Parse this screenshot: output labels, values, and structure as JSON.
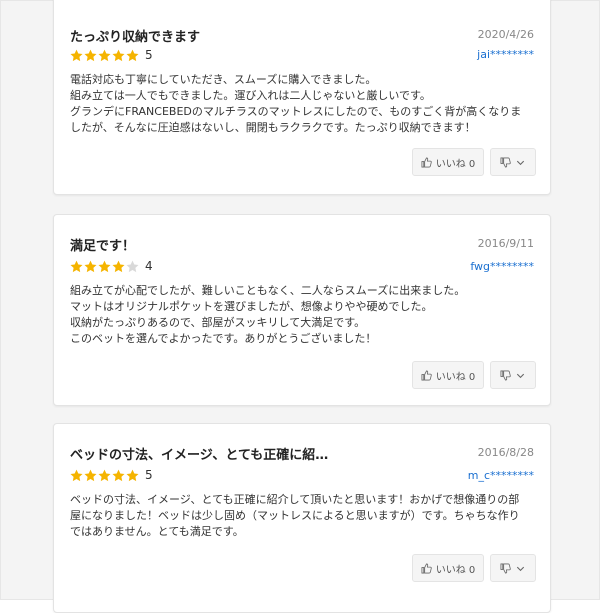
{
  "colors": {
    "star_filled": "#f5b400",
    "star_empty": "#d9d9d9",
    "username": "#1a6fd0",
    "date": "#888888"
  },
  "reviews": [
    {
      "title": "たっぷり収納できます",
      "date": "2020/4/26",
      "rating": 5,
      "rating_text": "5",
      "user": "jai********",
      "body": [
        "電話対応も丁寧にしていただき、スムーズに購入できました。",
        "組み立ては一人でもできました。運び入れは二人じゃないと厳しいです。",
        "グランデにFRANCEBEDのマルチラスのマットレスにしたので、ものすごく背が高くなりま",
        "したが、そんなに圧迫感はないし、開閉もラクラクです。たっぷり収納できます！"
      ],
      "like_label": "いいね 0"
    },
    {
      "title": "満足です！",
      "date": "2016/9/11",
      "rating": 4,
      "rating_text": "4",
      "user": "fwg********",
      "body": [
        "組み立てが心配でしたが、難しいこともなく、二人ならスムーズに出来ました。",
        "マットはオリジナルポケットを選びましたが、想像よりやや硬めでした。",
        "収納がたっぷりあるので、部屋がスッキリして大満足です。",
        "このベットを選んでよかったです。ありがとうございました！"
      ],
      "like_label": "いいね 0"
    },
    {
      "title": "ベッドの寸法、イメージ、とても正確に紹…",
      "date": "2016/8/28",
      "rating": 5,
      "rating_text": "5",
      "user": "m_c********",
      "body": [
        "ベッドの寸法、イメージ、とても正確に紹介して頂いたと思います！おかげで想像通りの部",
        "屋になりました！ベッドは少し固め（マットレスによると思いますが）です。ちゃちな作り",
        "ではありません。とても満足です。"
      ],
      "like_label": "いいね 0"
    }
  ]
}
